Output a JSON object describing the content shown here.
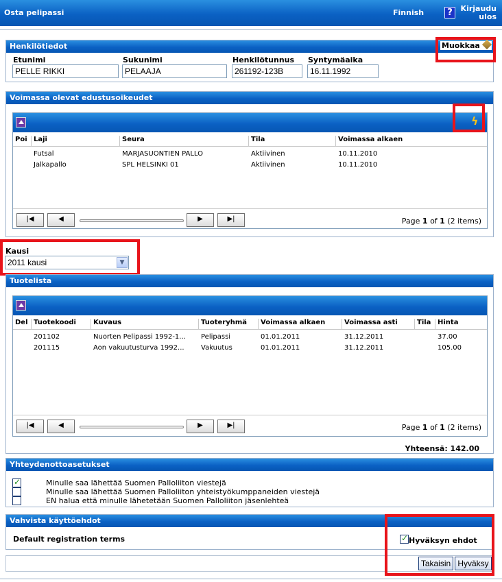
{
  "topbar": {
    "title": "Osta pelipassi",
    "language": "Finnish",
    "help_icon": "?",
    "logout_line1": "Kirjaudu",
    "logout_line2": "ulos"
  },
  "personal": {
    "header": "Henkilötiedot",
    "edit_label": "Muokkaa",
    "fields": [
      {
        "label": "Etunimi",
        "value": "PELLE RIKKI"
      },
      {
        "label": "Sukunimi",
        "value": "PELAAJA"
      },
      {
        "label": "Henkilötunnus",
        "value": "261192-123B"
      },
      {
        "label": "Syntymäaika",
        "value": "16.11.1992"
      }
    ]
  },
  "rights": {
    "header": "Voimassa olevat edustusoikeudet",
    "columns": [
      "Poi",
      "Laji",
      "Seura",
      "Tila",
      "Voimassa alkaen"
    ],
    "rows": [
      [
        "",
        "Futsal",
        "MARJASUONTIEN PALLO",
        "Aktiivinen",
        "10.11.2010"
      ],
      [
        "",
        "Jalkapallo",
        "SPL HELSINKI 01",
        "Aktiivinen",
        "10.11.2010"
      ]
    ],
    "pager": {
      "prefix": "Page",
      "page": "1",
      "of": "of",
      "total": "1",
      "items": "(2 items)"
    }
  },
  "season": {
    "label": "Kausi",
    "selected": "2011 kausi"
  },
  "products": {
    "header": "Tuotelista",
    "columns": [
      "Del",
      "Tuotekoodi",
      "Kuvaus",
      "Tuoteryhmä",
      "Voimassa alkaen",
      "Voimassa asti",
      "Tila",
      "Hinta"
    ],
    "rows": [
      [
        "",
        "201102",
        "Nuorten Pelipassi 1992-1...",
        "Pelipassi",
        "01.01.2011",
        "31.12.2011",
        "",
        "37.00"
      ],
      [
        "",
        "201115",
        "Aon vakuutusturva 1992...",
        "Vakuutus",
        "01.01.2011",
        "31.12.2011",
        "",
        "105.00"
      ]
    ],
    "pager": {
      "prefix": "Page",
      "page": "1",
      "of": "of",
      "total": "1",
      "items": "(2 items)"
    },
    "total": "Yhteensä: 142.00"
  },
  "contact": {
    "header": "Yhteydenottoasetukset",
    "options": [
      {
        "label": "Minulle saa lähettää Suomen Palloliiton viestejä",
        "checked": true
      },
      {
        "label": "Minulle saa lähettää Suomen Palloliiton yhteistyökumppaneiden viestejä",
        "checked": false
      },
      {
        "label": "EN halua että minulle lähetetään Suomen Palloliiton jäsenlehteä",
        "checked": false
      }
    ]
  },
  "terms": {
    "header": "Vahvista käyttöehdot",
    "text": "Default registration terms",
    "accept_label": "Hyväksyn ehdot",
    "accept_checked": true
  },
  "actions": {
    "back": "Takaisin",
    "confirm": "Hyväksy"
  },
  "colors": {
    "header_blue": "#0b61c4",
    "highlight_red": "#e8141b"
  }
}
